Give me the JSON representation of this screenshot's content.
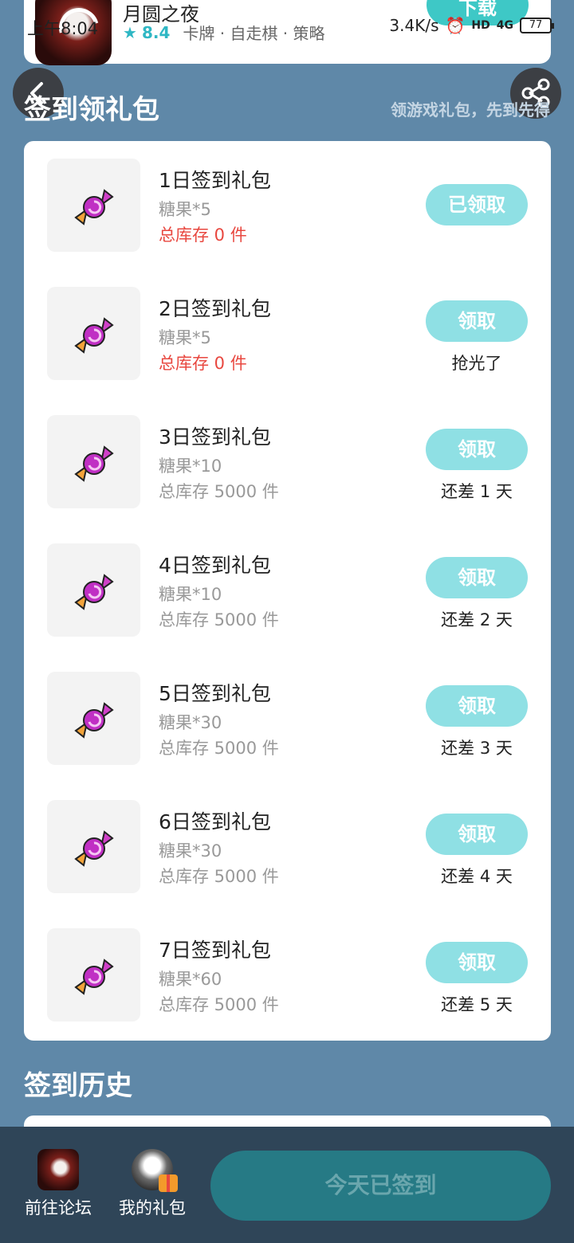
{
  "game": {
    "name": "月圆之夜",
    "score": "8.4",
    "tags": "卡牌 · 自走棋 · 策略",
    "download_label": "下载"
  },
  "status_bar": {
    "time": "上午8:04",
    "speed": "3.4K/s",
    "hd": "HD",
    "network": "4G",
    "battery": "77"
  },
  "icons": {
    "back": "chevron-left-icon",
    "share": "share-icon",
    "candy": "candy-icon",
    "star": "star-icon"
  },
  "signin": {
    "title": "签到领礼包",
    "hint": "领游戏礼包，先到先得",
    "gifts": [
      {
        "title": "1日签到礼包",
        "content": "糖果*5",
        "stock": "总库存 0 件",
        "button": "已领取",
        "status": ""
      },
      {
        "title": "2日签到礼包",
        "content": "糖果*5",
        "stock": "总库存 0 件",
        "button": "领取",
        "status": "抢光了"
      },
      {
        "title": "3日签到礼包",
        "content": "糖果*10",
        "stock": "总库存 5000 件",
        "button": "领取",
        "status": "还差 1 天"
      },
      {
        "title": "4日签到礼包",
        "content": "糖果*10",
        "stock": "总库存 5000 件",
        "button": "领取",
        "status": "还差 2 天"
      },
      {
        "title": "5日签到礼包",
        "content": "糖果*30",
        "stock": "总库存 5000 件",
        "button": "领取",
        "status": "还差 3 天"
      },
      {
        "title": "6日签到礼包",
        "content": "糖果*30",
        "stock": "总库存 5000 件",
        "button": "领取",
        "status": "还差 4 天"
      },
      {
        "title": "7日签到礼包",
        "content": "糖果*60",
        "stock": "总库存 5000 件",
        "button": "领取",
        "status": "还差 5 天"
      }
    ]
  },
  "history": {
    "title": "签到历史"
  },
  "bottom_bar": {
    "forum_label": "前往论坛",
    "mygift_label": "我的礼包",
    "signed_label": "今天已签到"
  },
  "colors": {
    "background": "#5f88a8",
    "accent": "#3ec8c6",
    "button_light": "#8fe0e4",
    "stock_empty": "#e8473f",
    "bottom_bar": "#2f4558"
  }
}
